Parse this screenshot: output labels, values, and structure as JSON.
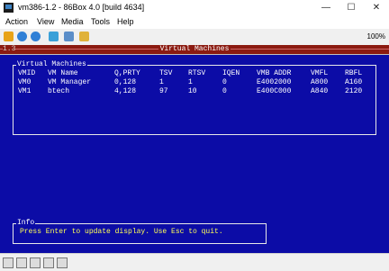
{
  "window": {
    "title": "vm386-1.2 - 86Box 4.0 [build 4634]",
    "minimize": "—",
    "maximize": "☐",
    "close": "✕"
  },
  "menu": [
    "Action",
    "View",
    "Media",
    "Tools",
    "Help"
  ],
  "toolbar": {
    "icons": [
      "pause-icon",
      "reset-icon",
      "power-icon",
      "settings-icon",
      "screenshot-icon",
      "hard-reset-icon"
    ],
    "zoom": "100%"
  },
  "screen": {
    "header_left": "1.3",
    "header_title": "Virtual Machines",
    "vm_panel": {
      "title": "Virtual Machines",
      "columns": [
        "VMID",
        "VM Name",
        "Q,PRTY",
        "TSV",
        "RTSV",
        "IQEN",
        "VMB ADDR",
        "VMFL",
        "RBFL"
      ],
      "rows": [
        [
          "VM0",
          "VM Manager",
          "0,128",
          "1",
          "1",
          "0",
          "E4002000",
          "A800",
          "A160"
        ],
        [
          "VM1",
          "btech",
          "4,128",
          "97",
          "10",
          "0",
          "E400C000",
          "A840",
          "2120"
        ]
      ]
    },
    "info_panel": {
      "title": "Info",
      "text": "Press Enter to update display.  Use Esc to quit."
    }
  },
  "status_icons": [
    "floppy-icon",
    "cdrom-icon",
    "hdd-icon",
    "network-icon",
    "keyboard-icon"
  ]
}
